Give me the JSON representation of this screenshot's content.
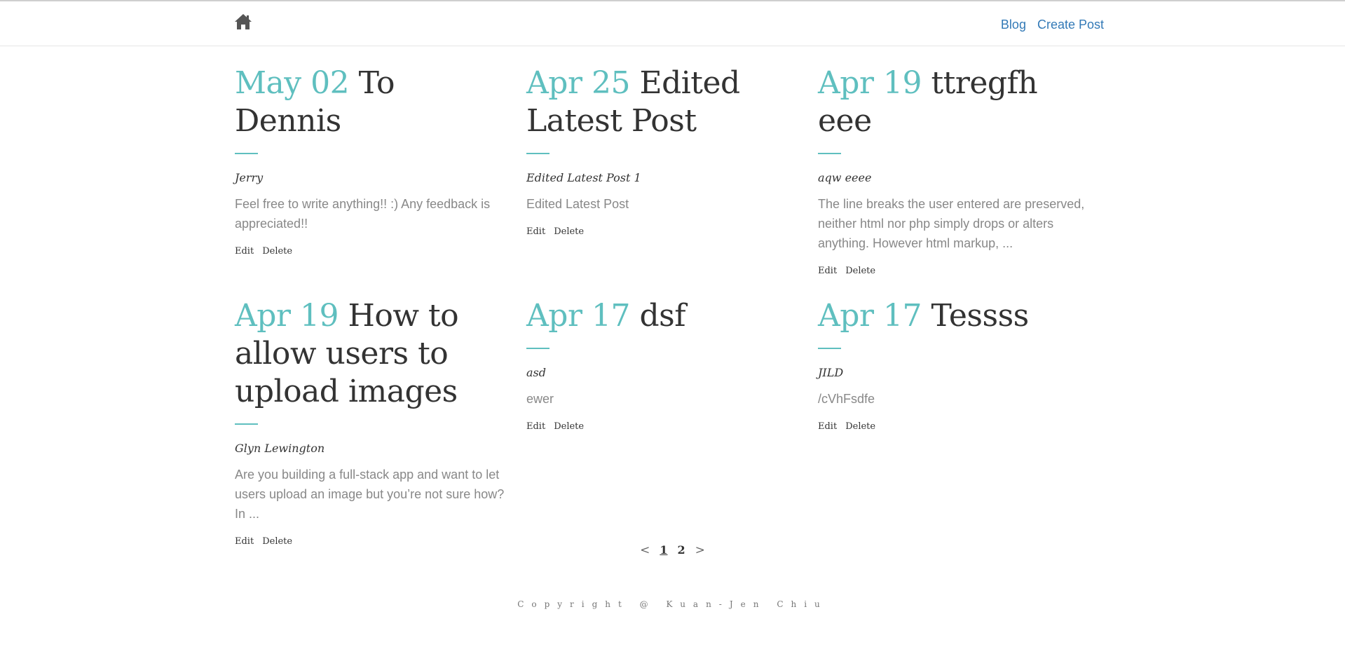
{
  "nav": {
    "home_icon": "home-icon",
    "links": [
      "Blog",
      "Create Post"
    ]
  },
  "colors": {
    "accent": "#5fbfbf",
    "link": "#337ab7",
    "text": "#333333",
    "muted": "#888888"
  },
  "posts": [
    {
      "date": "May 02",
      "title": "To Dennis",
      "author": "Jerry",
      "excerpt": "Feel free to write anything!! :) Any feedback is appreciated!!",
      "edit_label": "Edit",
      "delete_label": "Delete"
    },
    {
      "date": "Apr 25",
      "title": "Edited Latest Post",
      "author": "Edited Latest Post 1",
      "excerpt": "Edited Latest Post",
      "edit_label": "Edit",
      "delete_label": "Delete"
    },
    {
      "date": "Apr 19",
      "title": "ttregfh eee",
      "author": "aqw eeee",
      "excerpt": "The line breaks the user entered are preserved, neither html nor php simply drops or alters anything. However html markup, ...",
      "edit_label": "Edit",
      "delete_label": "Delete"
    },
    {
      "date": "Apr 19",
      "title": "How to allow users to upload images",
      "author": "Glyn Lewington",
      "excerpt": "Are you building a full-stack app and want to let users upload an image but you’re not sure how? In ...",
      "edit_label": "Edit",
      "delete_label": "Delete"
    },
    {
      "date": "Apr 17",
      "title": "dsf",
      "author": "asd",
      "excerpt": "ewer",
      "edit_label": "Edit",
      "delete_label": "Delete"
    },
    {
      "date": "Apr 17",
      "title": "Tessss",
      "author": "JILD",
      "excerpt": "/cVhFsdfe",
      "edit_label": "Edit",
      "delete_label": "Delete"
    }
  ],
  "pagination": {
    "prev": "<",
    "pages": [
      "1",
      "2"
    ],
    "current": "1",
    "next": ">"
  },
  "footer": {
    "text": "Copyright @ Kuan-Jen Chiu"
  }
}
